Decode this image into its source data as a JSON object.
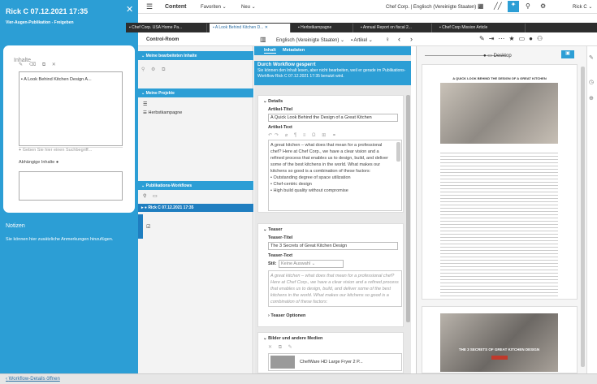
{
  "left_panel": {
    "title": "Rick C 07.12.2021 17:35",
    "subtitle": "Vier-Augen-Publikation - Freigeben",
    "contents_label": "Inhalte",
    "content_item": "A Look Behind Kitchen Design A...",
    "add_placeholder": "Geben Sie hier einen Suchbegriff...",
    "dependent_label": "Abhängige Inhalte",
    "notes_heading": "Notizen",
    "notes_text": "Sie können hier zusätzliche Anmerkungen hinzufügen."
  },
  "bottom_link": "Workflow-Details öffnen",
  "toolbar": {
    "app": "Content",
    "favoriten": "Favoriten",
    "neu": "Neu",
    "site": "Chef Corp. | Englisch (Vereinigte Staaten)",
    "user": "Rick C"
  },
  "tabs": [
    {
      "label": "Chef Corp. USA Home Pa..."
    },
    {
      "label": "A Look Behind Kitchen D..."
    },
    {
      "label": "Herbstkampagne"
    },
    {
      "label": "Annual Report on fiscal 2..."
    },
    {
      "label": "Chef Corp Mission Article"
    }
  ],
  "controls": {
    "control_room": "Control-Room",
    "locale": "Englisch (Vereinigte Staaten)",
    "doctype": "Artikel",
    "device": "Desktop"
  },
  "nav": {
    "my_content": "Meine bearbeiteten Inhalte",
    "my_projects": "Meine Projekte",
    "project_item": "Herbstkampagne",
    "workflows": "Publikations-Workflows",
    "workflow_item": "Rick C 07.12.2021 17:35"
  },
  "form": {
    "tab_content": "Inhalt",
    "tab_meta": "Metadaten",
    "warn_title": "Durch Workflow gesperrt",
    "warn_text": "Sie können den Inhalt lesen, aber nicht bearbeiten, weil er gerade im Publikations-Workflow Rick C 07.12.2021 17:35 benutzt wird.",
    "details": "Details",
    "article_title_label": "Artikel-Titel",
    "article_title": "A Quick Look Behind the Design of a Great Kitchen",
    "article_text_label": "Artikel-Text",
    "article_text": "A great kitchen – what does that mean for a professional chef? Here at Chef Corp., we have a clear vision and a refined process that enables us to design, build, and deliver some of the best kitchens in the world. What makes our kitchens so good is a combination of these factors:",
    "bullets": [
      "Outstanding degree of space utilization",
      "Chef-centric design",
      "High build quality without compromise"
    ],
    "teaser": "Teaser",
    "teaser_title_label": "Teaser-Titel",
    "teaser_title": "The 3 Secrets of Great Kitchen Design",
    "teaser_text_label": "Teaser-Text",
    "style_label": "Stil:",
    "style_value": "Keine Auswahl",
    "teaser_text": "A great kitchen – what does that mean for a professional chef? Here at Chef Corp., we have a clear vision and a refined process that enables us to design, build, and deliver some of the best kitchens in the world. What makes our kitchens so good is a combination of these factors:",
    "teaser_options": "Teaser Optionen",
    "media": "Bilder und andere Medien",
    "media_item": "ChefWare HD Large Fryer 2 P..."
  },
  "preview": {
    "headline": "A QUICK LOOK BEHIND THE DESIGN OF A GREAT KITCHEN",
    "banner": "THE 3 SECRETS OF GREAT KITCHEN DESIGN"
  }
}
